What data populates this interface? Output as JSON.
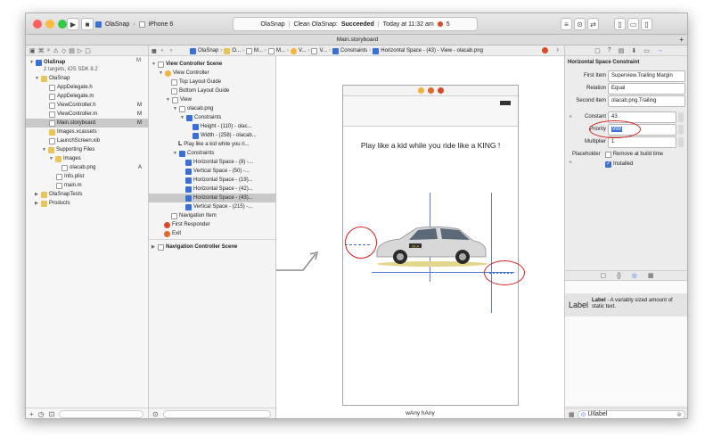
{
  "toolbar": {
    "scheme": "OlaSnap",
    "device": "iPhone 6",
    "status_project": "OlaSnap",
    "status_text": "Clean OlaSnap:",
    "status_result": "Succeeded",
    "status_time": "Today at 11:32 am",
    "error_count": "5"
  },
  "tab_title": "Main.storyboard",
  "navigator": {
    "project_name": "OlaSnap",
    "project_sub": "2 targets, iOS SDK 8.2",
    "project_badge": "M",
    "items": [
      {
        "label": "OlaSnap",
        "badge": ""
      },
      {
        "label": "AppDelegate.h",
        "badge": ""
      },
      {
        "label": "AppDelegate.m",
        "badge": ""
      },
      {
        "label": "ViewController.h",
        "badge": "M"
      },
      {
        "label": "ViewController.m",
        "badge": "M"
      },
      {
        "label": "Main.storyboard",
        "badge": "M"
      },
      {
        "label": "Images.xcassets",
        "badge": ""
      },
      {
        "label": "LaunchScreen.xib",
        "badge": ""
      },
      {
        "label": "Supporting Files",
        "badge": ""
      },
      {
        "label": "Images",
        "badge": ""
      },
      {
        "label": "olacab.png",
        "badge": "A"
      },
      {
        "label": "Info.plist",
        "badge": ""
      },
      {
        "label": "main.m",
        "badge": ""
      },
      {
        "label": "OlaSnapTests",
        "badge": ""
      },
      {
        "label": "Products",
        "badge": ""
      }
    ]
  },
  "breadcrumbs": [
    "OlaSnap",
    "O...",
    "M...",
    "M...",
    "V...",
    "V...",
    "Constraints",
    "Horizontal Space - (43) - View - olacab.png"
  ],
  "outline": {
    "items": [
      "View Controller Scene",
      "View Controller",
      "Top Layout Guide",
      "Bottom Layout Guide",
      "View",
      "olacab.png",
      "Constraints",
      "Height - (110) - olac...",
      "Width - (258) - olacab...",
      "Play like a kid while you ri...",
      "Constraints",
      "Horizontal Space - (8) -...",
      "Vertical Space - (50) -...",
      "Horizontal Space - (19)...",
      "Horizontal Space - (42)...",
      "Horizontal Space - (43)...",
      "Vertical Space - (215) -...",
      "Navigation Item",
      "First Responder",
      "Exit",
      "Navigation Controller Scene"
    ]
  },
  "canvas": {
    "headline": "Play like a kid while you ride like a KING !",
    "size_class": "wAny hAny",
    "car_brand": "OLA"
  },
  "inspector": {
    "title": "Horizontal Space Constraint",
    "first_item_label": "First Item",
    "first_item_value": "Superview.Trailing Margin",
    "relation_label": "Relation",
    "relation_value": "Equal",
    "second_item_label": "Second Item",
    "second_item_value": "olacab.png.Trailing",
    "constant_label": "Constant",
    "constant_value": "43",
    "priority_label": "Priority",
    "priority_value": "999",
    "multiplier_label": "Multiplier",
    "multiplier_value": "1",
    "placeholder_label": "Placeholder",
    "placeholder_option": "Remove at build time",
    "installed_label": "Installed",
    "library_item_name": "Label",
    "library_item_title": "Label",
    "library_item_desc": "- A variably sized amount of static text.",
    "filter_value": "UIlabel"
  },
  "colors": {
    "accent": "#3b6fd8",
    "annotation": "#d42020",
    "succeeded": "#222222"
  }
}
